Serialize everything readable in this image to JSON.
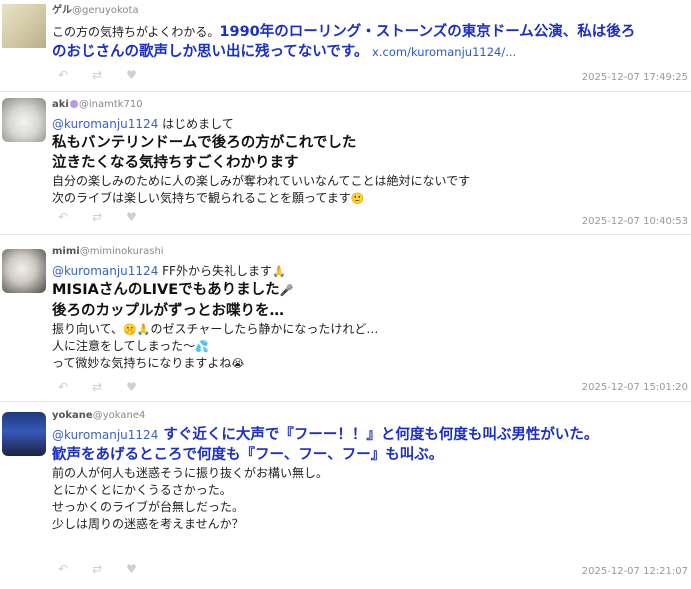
{
  "posts": [
    {
      "user": "ゲル",
      "handle": "@geruyokota",
      "lines": [
        {
          "parts": [
            {
              "t": "この方の気持ちがよくわかる。"
            },
            {
              "t": "1990年のローリング・ストーンズの東京ドーム公演、私は後ろ",
              "c": "hl"
            }
          ]
        },
        {
          "parts": [
            {
              "t": "のおじさんの歌声しか思い出に残ってないです。",
              "c": "hl"
            },
            {
              "t": "  x.com/kuromanju1124/...",
              "c": "link"
            }
          ]
        }
      ],
      "timestamp": "2025-12-07 17:49:25"
    },
    {
      "user": "aki",
      "badge": true,
      "handle": "@inamtk710",
      "lines": [
        {
          "parts": [
            {
              "t": "@kuromanju1124",
              "c": "mention"
            },
            {
              "t": " はじめまして"
            }
          ]
        },
        {
          "parts": [
            {
              "t": "私もバンテリンドームで後ろの方がこれでした",
              "c": "big"
            }
          ]
        },
        {
          "parts": [
            {
              "t": "泣きたくなる気持ちすごくわかります",
              "c": "big"
            }
          ]
        },
        {
          "parts": [
            {
              "t": "自分の楽しみのために人の楽しみが奪われていいなんてことは絶対にないです"
            }
          ]
        },
        {
          "parts": [
            {
              "t": "次のライブは楽しい気持ちで観られることを願ってます"
            },
            {
              "t": "🙂",
              "c": "emoji"
            }
          ]
        }
      ],
      "timestamp": "2025-12-07 10:40:53"
    },
    {
      "user": "mimi",
      "handle": "@miminokurashi",
      "lines": [
        {
          "parts": [
            {
              "t": "@kuromanju1124",
              "c": "mention"
            },
            {
              "t": " FF外から失礼します"
            },
            {
              "t": "🙏",
              "c": "emoji"
            }
          ]
        },
        {
          "parts": [
            {
              "t": "MISIAさんのLIVEでもありました",
              "c": "big"
            },
            {
              "t": "🎤",
              "c": "emoji"
            }
          ]
        },
        {
          "parts": [
            {
              "t": "後ろのカップルがずっとお喋りを…",
              "c": "big"
            }
          ]
        },
        {
          "parts": [
            {
              "t": "振り向いて、"
            },
            {
              "t": "🤫🙏",
              "c": "emoji"
            },
            {
              "t": "のゼスチャーしたら静かになったけれど…"
            }
          ]
        },
        {
          "parts": [
            {
              "t": "人に注意をしてしまった〜"
            },
            {
              "t": "💦",
              "c": "emoji"
            }
          ]
        },
        {
          "parts": [
            {
              "t": "って微妙な気持ちになりますよね"
            },
            {
              "t": "😭",
              "c": "emoji"
            }
          ]
        }
      ],
      "timestamp": "2025-12-07 15:01:20"
    },
    {
      "user": "yokane",
      "handle": "@yokane4",
      "lines": [
        {
          "parts": [
            {
              "t": "@kuromanju1124",
              "c": "mention"
            },
            {
              "t": " すぐ近くに大声で『フーー！！』と何度も何度も叫ぶ男性がいた。",
              "c": "hl"
            }
          ]
        },
        {
          "parts": [
            {
              "t": "歓声をあげるところで何度も『フー、フー、フー』も叫ぶ。",
              "c": "hl"
            }
          ]
        },
        {
          "parts": [
            {
              "t": "前の人が何人も迷惑そうに振り抜くがお構い無し。"
            }
          ]
        },
        {
          "parts": [
            {
              "t": "とにかくとにかくうるさかった。"
            }
          ]
        },
        {
          "parts": [
            {
              "t": "せっかくのライブが台無しだった。"
            }
          ]
        },
        {
          "parts": [
            {
              "t": " "
            }
          ]
        },
        {
          "parts": [
            {
              "t": "少しは周りの迷惑を考えませんか？"
            }
          ]
        }
      ],
      "timestamp": "2025-12-07 12:21:07"
    }
  ],
  "icons": {
    "reply": "reply-icon",
    "retweet": "retweet-icon",
    "like": "heart-icon"
  }
}
